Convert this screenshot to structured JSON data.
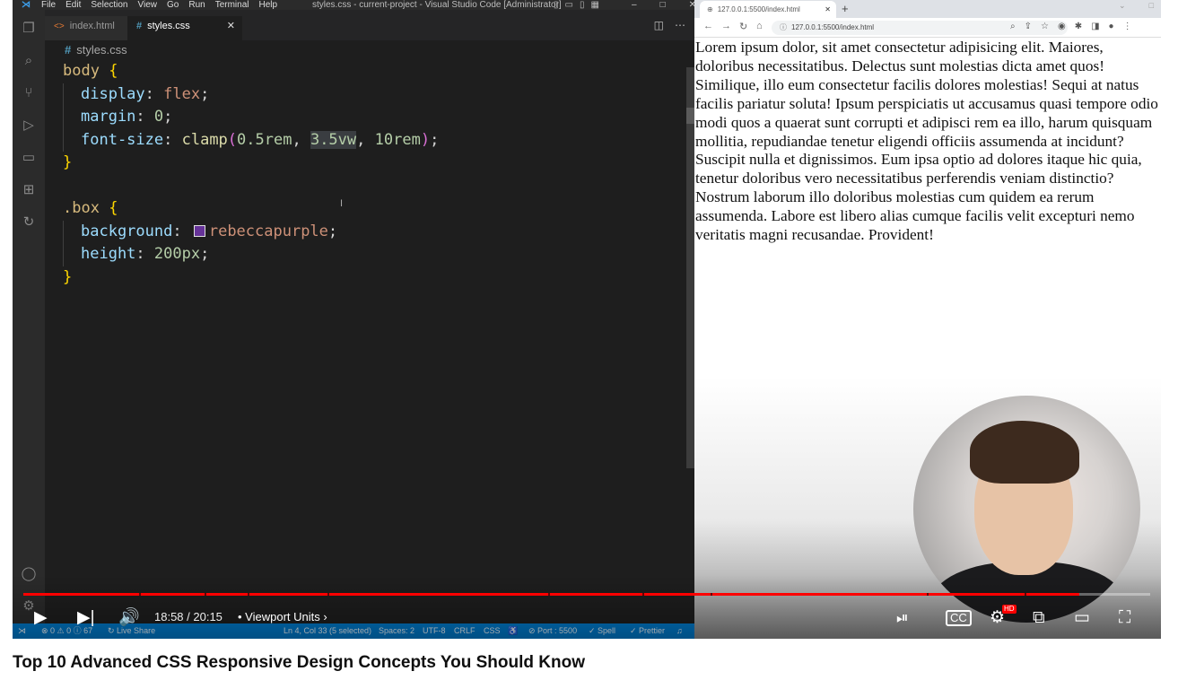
{
  "vscode": {
    "menu": [
      "File",
      "Edit",
      "Selection",
      "View",
      "Go",
      "Run",
      "Terminal",
      "Help"
    ],
    "window_title": "styles.css - current-project - Visual Studio Code [Administrator]",
    "tabs": [
      {
        "label": "index.html"
      },
      {
        "label": "styles.css"
      }
    ],
    "breadcrumb": "styles.css",
    "code": {
      "body_selector": "body",
      "display_prop": "display",
      "display_val": "flex",
      "margin_prop": "margin",
      "margin_val": "0",
      "font_size_prop": "font-size",
      "clamp_fn": "clamp",
      "clamp_arg1": "0.5rem",
      "clamp_arg2": "3.5vw",
      "clamp_arg3": "10rem",
      "box_selector": ".box",
      "background_prop": "background",
      "background_val": "rebeccapurple",
      "height_prop": "height",
      "height_val": "200px"
    },
    "status": {
      "problems": "⊗ 0 ⚠ 0 ⓘ 67",
      "live_share": "Live Share",
      "position": "Ln 4, Col 33 (5 selected)",
      "spaces": "Spaces: 2",
      "encoding": "UTF-8",
      "eol": "CRLF",
      "language": "CSS",
      "port": "⊘ Port : 5500",
      "spell": "✓ Spell",
      "prettier": "✓ Prettier"
    }
  },
  "browser": {
    "tab_title": "127.0.0.1:5500/index.html",
    "url": "127.0.0.1:5500/index.html",
    "page_text": "Lorem ipsum dolor, sit amet consectetur adipisicing elit. Maiores, doloribus necessitatibus. Delectus sunt molestias dicta amet quos! Similique, illo eum consectetur facilis dolores molestias! Sequi at natus facilis pariatur soluta! Ipsum perspiciatis ut accusamus quasi tempore odio modi quos a quaerat sunt corrupti et adipisci rem ea illo, harum quisquam mollitia, repudiandae tenetur eligendi officiis assumenda at incidunt? Suscipit nulla et dignissimos. Eum ipsa optio ad dolores itaque hic quia, tenetur doloribus vero necessitatibus perferendis veniam distinctio? Nostrum laborum illo doloribus molestias cum quidem ea rerum assumenda. Labore est libero alias cumque facilis velit excepturi nemo veritatis magni recusandae. Provident!"
  },
  "player": {
    "current_time": "18:58",
    "duration": "20:15",
    "time_display": "18:58 / 20:15",
    "chapter": "Viewport Units",
    "progress_fraction": 0.937,
    "settings_badge": "HD",
    "colors": {
      "progress": "#ff0000",
      "accent": "#007acc"
    }
  },
  "video_title": "Top 10 Advanced CSS Responsive Design Concepts You Should Know"
}
